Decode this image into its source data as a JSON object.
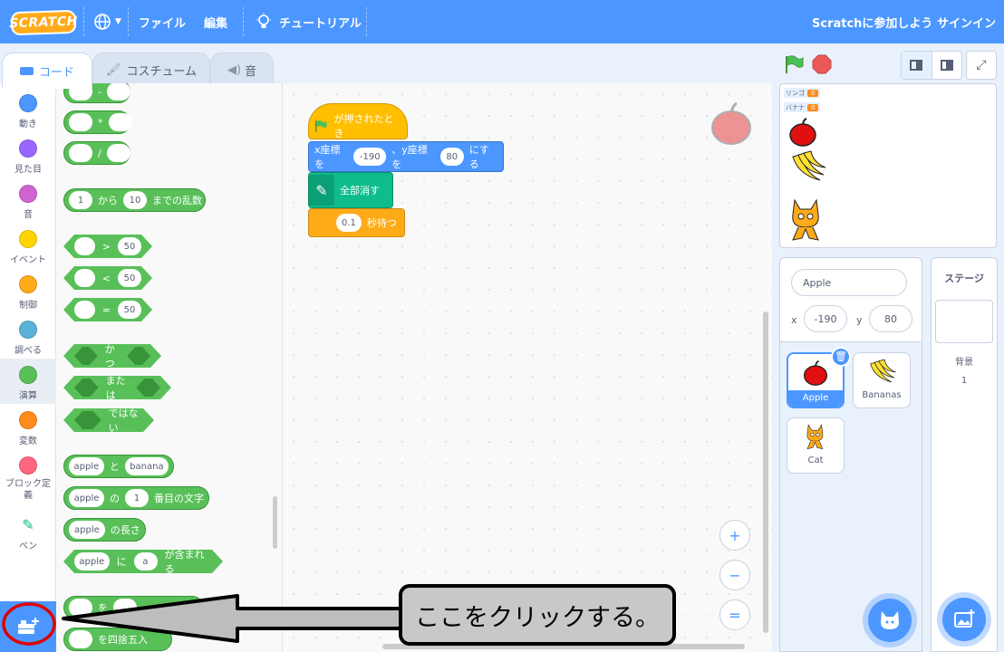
{
  "menubar": {
    "logo": "SCRATCH",
    "file_label": "ファイル",
    "edit_label": "編集",
    "tutorial_label": "チュートリアル",
    "join_label": "Scratchに参加しよう",
    "signin_label": "サインイン"
  },
  "tabs": [
    {
      "label": "コード"
    },
    {
      "label": "コスチューム"
    },
    {
      "label": "音"
    }
  ],
  "categories": [
    {
      "label": "動き",
      "color": "#4c97ff"
    },
    {
      "label": "見た目",
      "color": "#9966ff"
    },
    {
      "label": "音",
      "color": "#cf63cf"
    },
    {
      "label": "イベント",
      "color": "#ffd500"
    },
    {
      "label": "制御",
      "color": "#ffab19"
    },
    {
      "label": "調べる",
      "color": "#5cb1d6"
    },
    {
      "label": "演算",
      "color": "#59c059"
    },
    {
      "label": "変数",
      "color": "#ff8c1a"
    },
    {
      "label": "ブロック定義",
      "color": "#ff6680"
    },
    {
      "label": "ペン",
      "color": "#0fbd8c"
    }
  ],
  "palette": {
    "minus_op": "-",
    "times_op": "*",
    "divide_op": "/",
    "random": {
      "from": "1",
      "from_label": "から",
      "to": "10",
      "to_label": "までの乱数"
    },
    "gt": {
      "op": ">",
      "value": "50"
    },
    "lt": {
      "op": "<",
      "value": "50"
    },
    "eq": {
      "op": "=",
      "value": "50"
    },
    "and_label": "かつ",
    "or_label": "または",
    "not_label": "ではない",
    "join": {
      "a": "apple",
      "mid": "と",
      "b": "banana"
    },
    "letter": {
      "a": "apple",
      "mid": "の",
      "n": "1",
      "suffix": "番目の文字"
    },
    "length": {
      "a": "apple",
      "suffix": "の長さ"
    },
    "contains": {
      "a": "apple",
      "mid": "に",
      "b": "a",
      "suffix": "が含まれる"
    },
    "mod": {
      "mid": "を"
    },
    "round": {
      "suffix": "を四捨五入"
    }
  },
  "script": {
    "hat_label": "が押されたとき",
    "goto_x_label": "x座標を",
    "x_value": "-190",
    "goto_mid": "、y座標を",
    "y_value": "80",
    "goto_suffix": "にする",
    "clear_label": "全部消す",
    "wait_value": "0.1",
    "wait_label": "秒待つ"
  },
  "zoom": {
    "in": "+",
    "out": "−",
    "reset": "="
  },
  "stage": {
    "monitor1_label": "リンゴ",
    "monitor1_value": "0",
    "monitor2_label": "バナナ",
    "monitor2_value": "0"
  },
  "sprite_info": {
    "name": "Apple",
    "x_label": "x",
    "x_value": "-190",
    "y_label": "y",
    "y_value": "80"
  },
  "sprites": [
    {
      "name": "Apple"
    },
    {
      "name": "Bananas"
    },
    {
      "name": "Cat"
    }
  ],
  "stage_pane": {
    "title": "ステージ",
    "backdrops_label": "背景",
    "backdrops_count": "1"
  },
  "callout": {
    "text": "ここをクリックする。"
  }
}
